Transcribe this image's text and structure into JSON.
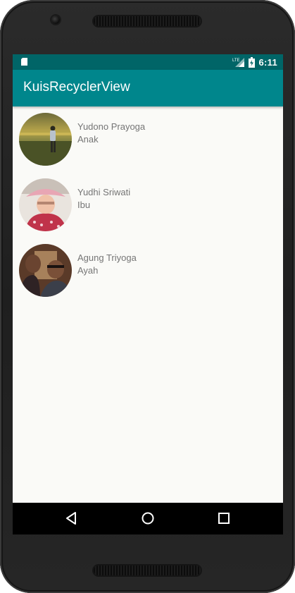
{
  "status_bar": {
    "time": "6:11",
    "network_label": "LTE",
    "icons": [
      "sd-card-icon",
      "lte-signal-icon",
      "battery-charging-icon"
    ]
  },
  "app_bar": {
    "title": "KuisRecyclerView",
    "color": "#00868c",
    "status_color": "#006567"
  },
  "items": [
    {
      "name": "Yudono Prayoga",
      "role": "Anak"
    },
    {
      "name": "Yudhi Sriwati",
      "role": "Ibu"
    },
    {
      "name": "Agung Triyoga",
      "role": "Ayah"
    }
  ],
  "nav_bar": {
    "buttons": [
      "back-icon",
      "home-icon",
      "recents-icon"
    ]
  }
}
